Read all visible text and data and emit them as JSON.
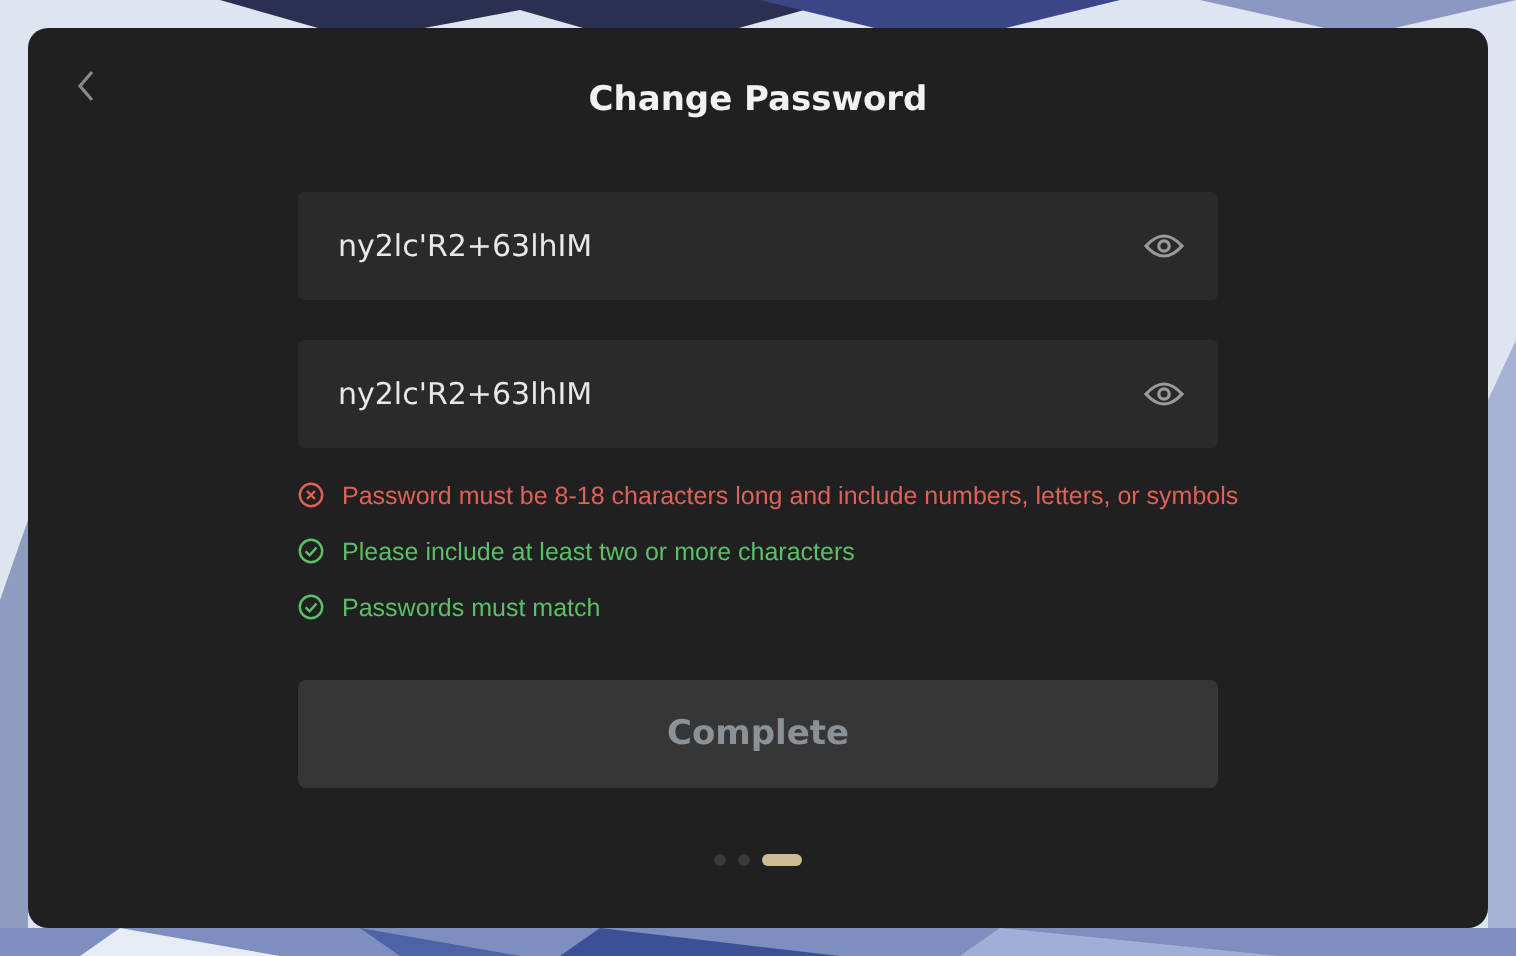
{
  "dialog": {
    "title": "Change Password",
    "fields": [
      {
        "value": "ny2lc'R2+63lhIM"
      },
      {
        "value": "ny2lc'R2+63lhIM"
      }
    ],
    "rules": [
      {
        "text": "Password must be 8-18 characters long and include numbers, letters, or symbols",
        "met": false
      },
      {
        "text": "Please include at least two or more characters",
        "met": true
      },
      {
        "text": "Passwords must match",
        "met": true
      }
    ],
    "button": {
      "label": "Complete",
      "disabled": true
    },
    "steps": [
      {
        "selected": false
      },
      {
        "selected": false
      },
      {
        "selected": true
      }
    ]
  }
}
